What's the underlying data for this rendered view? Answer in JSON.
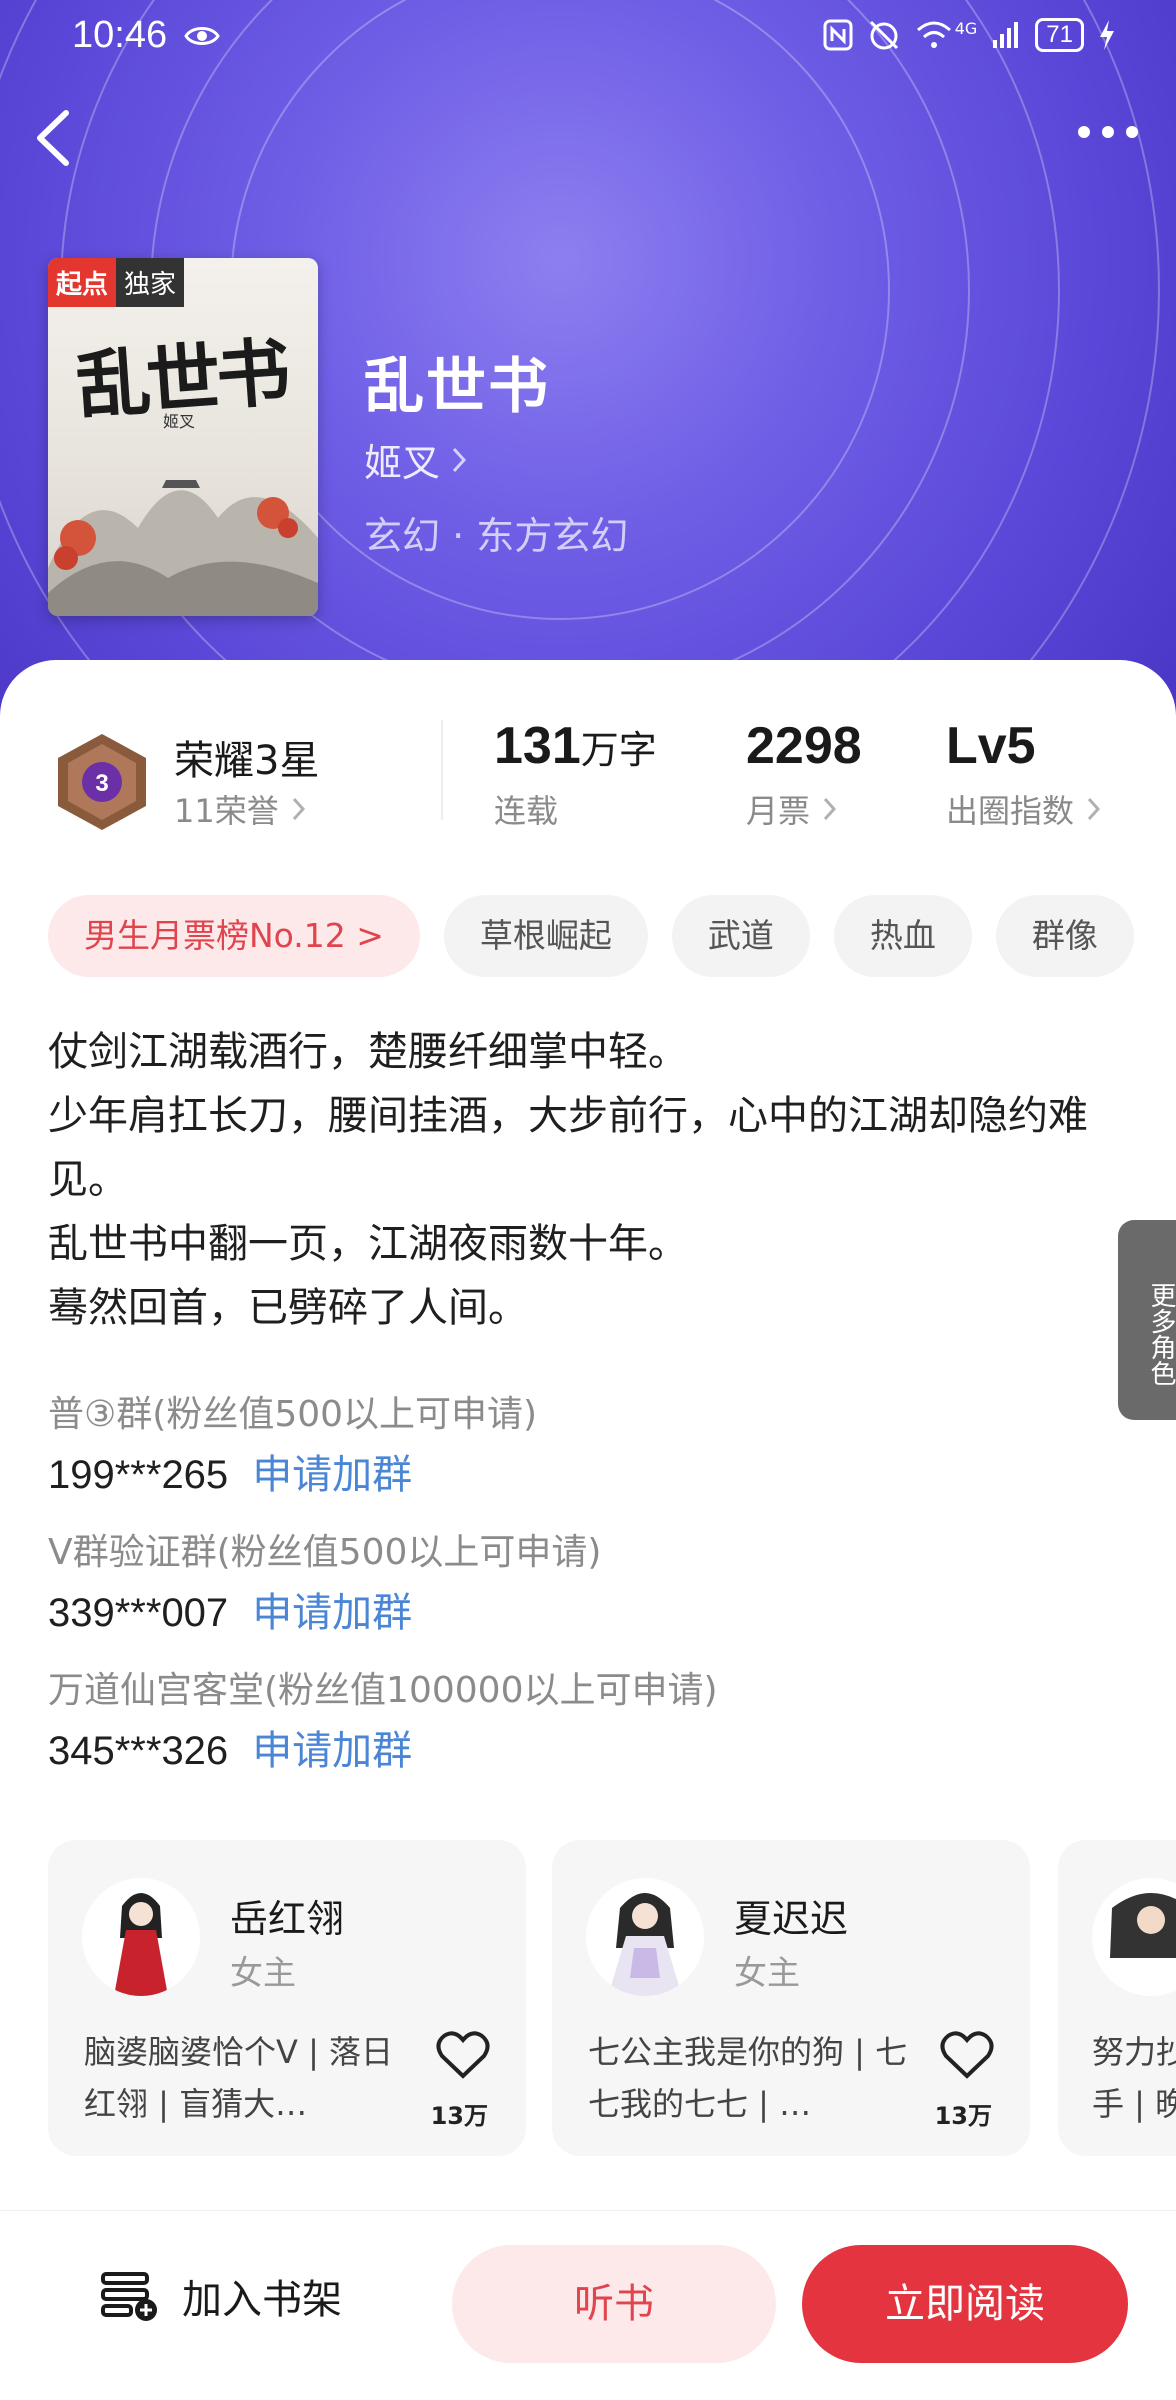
{
  "status_bar": {
    "time": "10:46",
    "battery": "71",
    "network": "4G"
  },
  "book": {
    "title": "乱世书",
    "author": "姬叉",
    "genre": "玄幻 · 东方玄幻",
    "cover": {
      "badge_source": "起点",
      "badge_exclusive": "独家",
      "cover_title": "乱世书",
      "cover_author": "姬叉"
    }
  },
  "stats": {
    "honor": {
      "title": "荣耀3星",
      "sub": "11荣誉",
      "level_badge": "3"
    },
    "words": {
      "value": "131",
      "unit": "万字",
      "sub": "连载"
    },
    "monthly": {
      "value": "2298",
      "sub": "月票"
    },
    "circle": {
      "value": "Lv5",
      "sub": "出圈指数"
    }
  },
  "tags": [
    "男生月票榜No.12 >",
    "草根崛起",
    "武道",
    "热血",
    "群像"
  ],
  "description": [
    "仗剑江湖载酒行，楚腰纤细掌中轻。",
    "少年肩扛长刀，腰间挂酒，大步前行，心中的江湖却隐约难见。",
    "乱世书中翻一页，江湖夜雨数十年。",
    "蓦然回首，已劈碎了人间。"
  ],
  "groups": [
    {
      "name": "普③群(粉丝值500以上可申请)",
      "number": "199***265",
      "apply": "申请加群"
    },
    {
      "name": "V群验证群(粉丝值500以上可申请)",
      "number": "339***007",
      "apply": "申请加群"
    },
    {
      "name": "万道仙宫客堂(粉丝值100000以上可申请)",
      "number": "345***326",
      "apply": "申请加群"
    }
  ],
  "roles": [
    {
      "name": "岳红翎",
      "type": "女主",
      "desc": "脑婆脑婆恰个V | 落日红翎 | 盲猜大…",
      "likes": "13万"
    },
    {
      "name": "夏迟迟",
      "type": "女主",
      "desc": "七公主我是你的狗 | 七七我的七七 | …",
      "likes": "13万"
    },
    {
      "desc_line1": "努力抄",
      "desc_line2": "手 | 晚"
    }
  ],
  "more_roles_label": "更多角色",
  "bottom": {
    "shelf": "加入书架",
    "listen": "听书",
    "read": "立即阅读"
  },
  "colors": {
    "accent_red": "#e3343f",
    "hero_purple": "#5a47d8",
    "link_blue": "#4b86d6"
  }
}
